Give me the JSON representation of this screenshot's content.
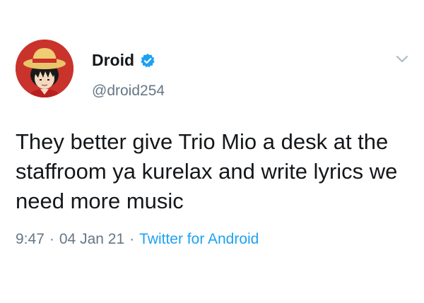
{
  "tweet": {
    "author": {
      "display_name": "Droid",
      "handle": "@droid254",
      "verified": true,
      "avatar_icon": "straw-hat-avatar-icon"
    },
    "text": "They better give Trio Mio a desk at the staffroom ya kurelax and write lyrics we need more music",
    "time": "9:47",
    "separator": "·",
    "date": "04 Jan 21",
    "source": "Twitter for Android"
  },
  "colors": {
    "verified": "#1da1f2",
    "muted": "#657786",
    "link": "#1da1f2",
    "text": "#14171a"
  }
}
